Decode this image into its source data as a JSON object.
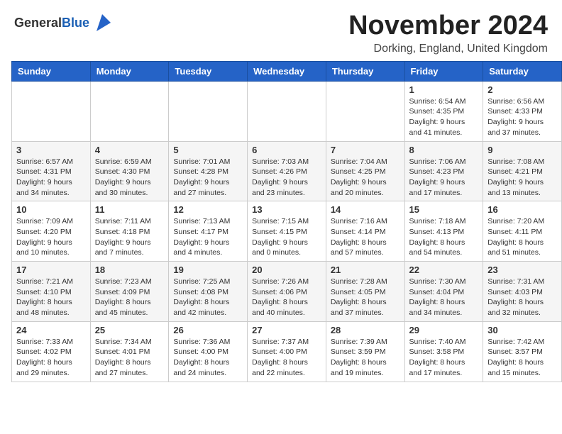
{
  "header": {
    "logo_general": "General",
    "logo_blue": "Blue",
    "month_title": "November 2024",
    "location": "Dorking, England, United Kingdom"
  },
  "calendar": {
    "days_of_week": [
      "Sunday",
      "Monday",
      "Tuesday",
      "Wednesday",
      "Thursday",
      "Friday",
      "Saturday"
    ],
    "weeks": [
      [
        {
          "day": "",
          "info": ""
        },
        {
          "day": "",
          "info": ""
        },
        {
          "day": "",
          "info": ""
        },
        {
          "day": "",
          "info": ""
        },
        {
          "day": "",
          "info": ""
        },
        {
          "day": "1",
          "info": "Sunrise: 6:54 AM\nSunset: 4:35 PM\nDaylight: 9 hours and 41 minutes."
        },
        {
          "day": "2",
          "info": "Sunrise: 6:56 AM\nSunset: 4:33 PM\nDaylight: 9 hours and 37 minutes."
        }
      ],
      [
        {
          "day": "3",
          "info": "Sunrise: 6:57 AM\nSunset: 4:31 PM\nDaylight: 9 hours and 34 minutes."
        },
        {
          "day": "4",
          "info": "Sunrise: 6:59 AM\nSunset: 4:30 PM\nDaylight: 9 hours and 30 minutes."
        },
        {
          "day": "5",
          "info": "Sunrise: 7:01 AM\nSunset: 4:28 PM\nDaylight: 9 hours and 27 minutes."
        },
        {
          "day": "6",
          "info": "Sunrise: 7:03 AM\nSunset: 4:26 PM\nDaylight: 9 hours and 23 minutes."
        },
        {
          "day": "7",
          "info": "Sunrise: 7:04 AM\nSunset: 4:25 PM\nDaylight: 9 hours and 20 minutes."
        },
        {
          "day": "8",
          "info": "Sunrise: 7:06 AM\nSunset: 4:23 PM\nDaylight: 9 hours and 17 minutes."
        },
        {
          "day": "9",
          "info": "Sunrise: 7:08 AM\nSunset: 4:21 PM\nDaylight: 9 hours and 13 minutes."
        }
      ],
      [
        {
          "day": "10",
          "info": "Sunrise: 7:09 AM\nSunset: 4:20 PM\nDaylight: 9 hours and 10 minutes."
        },
        {
          "day": "11",
          "info": "Sunrise: 7:11 AM\nSunset: 4:18 PM\nDaylight: 9 hours and 7 minutes."
        },
        {
          "day": "12",
          "info": "Sunrise: 7:13 AM\nSunset: 4:17 PM\nDaylight: 9 hours and 4 minutes."
        },
        {
          "day": "13",
          "info": "Sunrise: 7:15 AM\nSunset: 4:15 PM\nDaylight: 9 hours and 0 minutes."
        },
        {
          "day": "14",
          "info": "Sunrise: 7:16 AM\nSunset: 4:14 PM\nDaylight: 8 hours and 57 minutes."
        },
        {
          "day": "15",
          "info": "Sunrise: 7:18 AM\nSunset: 4:13 PM\nDaylight: 8 hours and 54 minutes."
        },
        {
          "day": "16",
          "info": "Sunrise: 7:20 AM\nSunset: 4:11 PM\nDaylight: 8 hours and 51 minutes."
        }
      ],
      [
        {
          "day": "17",
          "info": "Sunrise: 7:21 AM\nSunset: 4:10 PM\nDaylight: 8 hours and 48 minutes."
        },
        {
          "day": "18",
          "info": "Sunrise: 7:23 AM\nSunset: 4:09 PM\nDaylight: 8 hours and 45 minutes."
        },
        {
          "day": "19",
          "info": "Sunrise: 7:25 AM\nSunset: 4:08 PM\nDaylight: 8 hours and 42 minutes."
        },
        {
          "day": "20",
          "info": "Sunrise: 7:26 AM\nSunset: 4:06 PM\nDaylight: 8 hours and 40 minutes."
        },
        {
          "day": "21",
          "info": "Sunrise: 7:28 AM\nSunset: 4:05 PM\nDaylight: 8 hours and 37 minutes."
        },
        {
          "day": "22",
          "info": "Sunrise: 7:30 AM\nSunset: 4:04 PM\nDaylight: 8 hours and 34 minutes."
        },
        {
          "day": "23",
          "info": "Sunrise: 7:31 AM\nSunset: 4:03 PM\nDaylight: 8 hours and 32 minutes."
        }
      ],
      [
        {
          "day": "24",
          "info": "Sunrise: 7:33 AM\nSunset: 4:02 PM\nDaylight: 8 hours and 29 minutes."
        },
        {
          "day": "25",
          "info": "Sunrise: 7:34 AM\nSunset: 4:01 PM\nDaylight: 8 hours and 27 minutes."
        },
        {
          "day": "26",
          "info": "Sunrise: 7:36 AM\nSunset: 4:00 PM\nDaylight: 8 hours and 24 minutes."
        },
        {
          "day": "27",
          "info": "Sunrise: 7:37 AM\nSunset: 4:00 PM\nDaylight: 8 hours and 22 minutes."
        },
        {
          "day": "28",
          "info": "Sunrise: 7:39 AM\nSunset: 3:59 PM\nDaylight: 8 hours and 19 minutes."
        },
        {
          "day": "29",
          "info": "Sunrise: 7:40 AM\nSunset: 3:58 PM\nDaylight: 8 hours and 17 minutes."
        },
        {
          "day": "30",
          "info": "Sunrise: 7:42 AM\nSunset: 3:57 PM\nDaylight: 8 hours and 15 minutes."
        }
      ]
    ]
  }
}
